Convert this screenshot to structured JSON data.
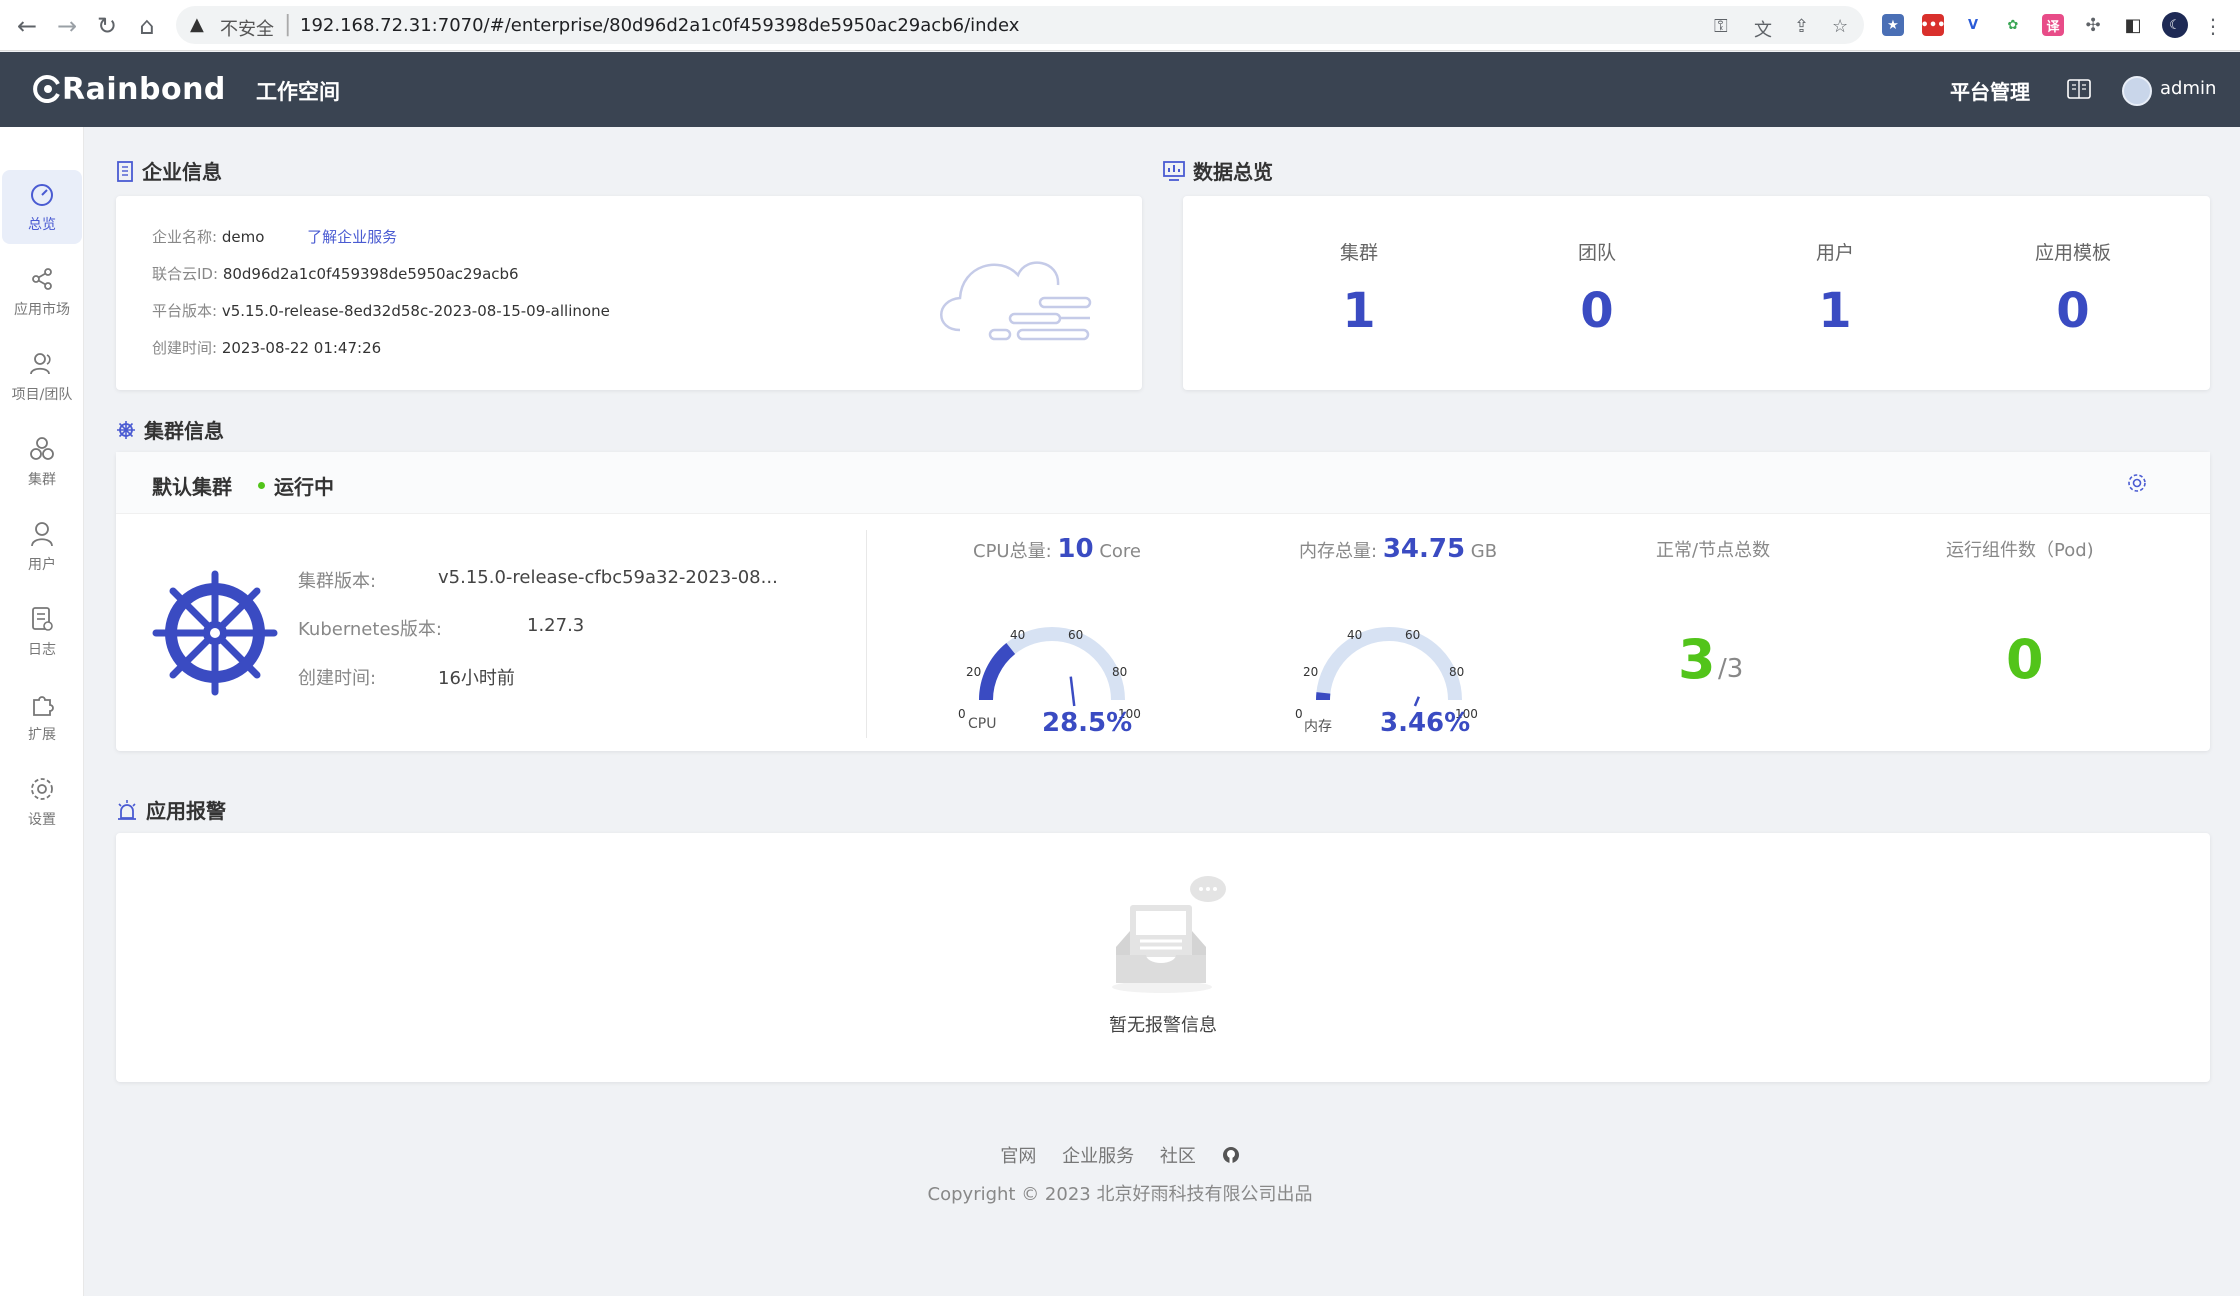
{
  "browser": {
    "insecure_label": "不安全",
    "url": "192.168.72.31:7070/#/enterprise/80d96d2a1c0f459398de5950ac29acb6/index"
  },
  "header": {
    "logo": "Rainbond",
    "workspace": "工作空间",
    "platform_admin": "平台管理",
    "username": "admin"
  },
  "sidebar": {
    "items": [
      {
        "label": "总览",
        "icon": "dashboard-icon",
        "active": true
      },
      {
        "label": "应用市场",
        "icon": "share-icon"
      },
      {
        "label": "项目/团队",
        "icon": "team-icon"
      },
      {
        "label": "集群",
        "icon": "cluster-icon"
      },
      {
        "label": "用户",
        "icon": "user-icon"
      },
      {
        "label": "日志",
        "icon": "log-icon"
      },
      {
        "label": "扩展",
        "icon": "puzzle-icon"
      },
      {
        "label": "设置",
        "icon": "gear-icon"
      }
    ]
  },
  "enterprise": {
    "title": "企业信息",
    "name_key": "企业名称:",
    "name_val": "demo",
    "learn_link": "了解企业服务",
    "id_key": "联合云ID:",
    "id_val": "80d96d2a1c0f459398de5950ac29acb6",
    "version_key": "平台版本:",
    "version_val": "v5.15.0-release-8ed32d58c-2023-08-15-09-allinone",
    "created_key": "创建时间:",
    "created_val": "2023-08-22 01:47:26"
  },
  "overview": {
    "title": "数据总览",
    "items": [
      {
        "label": "集群",
        "value": "1"
      },
      {
        "label": "团队",
        "value": "0"
      },
      {
        "label": "用户",
        "value": "1"
      },
      {
        "label": "应用模板",
        "value": "0"
      }
    ]
  },
  "cluster": {
    "section_title": "集群信息",
    "name": "默认集群",
    "status": "运行中",
    "version_key": "集群版本:",
    "version_val": "v5.15.0-release-cfbc59a32-2023-08...",
    "k8s_key": "Kubernetes版本:",
    "k8s_val": "1.27.3",
    "created_key": "创建时间:",
    "created_val": "16小时前",
    "cpu": {
      "title_prefix": "CPU总量:",
      "total": "10",
      "unit": "Core",
      "label": "CPU",
      "percent_text": "28.5%",
      "percent": 28.5
    },
    "memory": {
      "title_prefix": "内存总量:",
      "total": "34.75",
      "unit": "GB",
      "label": "内存",
      "percent_text": "3.46%",
      "percent": 3.46
    },
    "gauge_ticks": [
      "0",
      "20",
      "40",
      "60",
      "80",
      "100"
    ],
    "nodes": {
      "title": "正常/节点总数",
      "healthy": "3",
      "total": "/3"
    },
    "pods": {
      "title": "运行组件数（Pod)",
      "value": "0"
    }
  },
  "alerts": {
    "title": "应用报警",
    "empty_text": "暂无报警信息"
  },
  "footer": {
    "links": [
      "官网",
      "企业服务",
      "社区"
    ],
    "copyright": "Copyright © 2023 北京好雨科技有限公司出品"
  },
  "colors": {
    "accent": "#3a4bc2",
    "header_bg": "#3a4452",
    "success": "#52c41a"
  }
}
